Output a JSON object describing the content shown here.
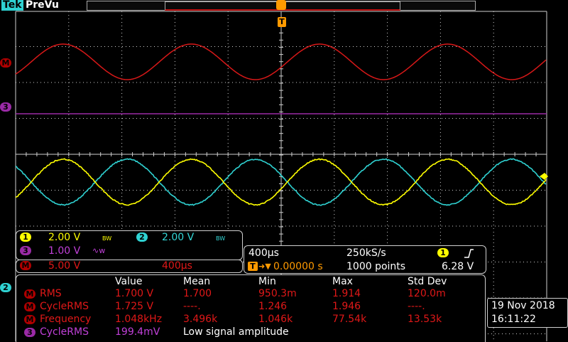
{
  "header": {
    "brand": "Tek",
    "mode": "PreVu"
  },
  "trigger_marker": {
    "label": "T"
  },
  "colors": {
    "ch1": "#ffff00",
    "ch2": "#2fd2d2",
    "ch3": "#9a2aa6",
    "math": "#d81818",
    "graticule": "#cfcfcf"
  },
  "channel_markers": {
    "math": "M",
    "ch3": "3",
    "ch2": "2"
  },
  "channels": {
    "ch1": {
      "badge": "1",
      "scale": "2.00 V",
      "bw": "BW"
    },
    "ch2": {
      "badge": "2",
      "scale": "2.00 V",
      "bw": "BW"
    },
    "ch3": {
      "badge": "3",
      "scale": "1.00 V",
      "filter": "∿w"
    },
    "math": {
      "badge": "M",
      "scale": "5.00 V",
      "time": "400µs"
    }
  },
  "timebase": {
    "horizontal": "400µs",
    "sample_rate": "250kS/s",
    "trigger_source": "1",
    "trigger_slope": "rising",
    "trigger_position": "0.00000 s",
    "record_length": "1000 points",
    "trigger_level": "6.28 V"
  },
  "measurements": {
    "headers": [
      "Value",
      "Mean",
      "Min",
      "Max",
      "Std Dev"
    ],
    "rows": [
      {
        "source": "M",
        "name": "RMS",
        "value": "1.700 V",
        "mean": "1.700",
        "min": "950.3m",
        "max": "1.914",
        "std": "120.0m"
      },
      {
        "source": "M",
        "name": "CycleRMS",
        "value": "1.725 V",
        "mean": "----.",
        "min": "1.246",
        "max": "1.946",
        "std": "----."
      },
      {
        "source": "M",
        "name": "Frequency",
        "value": "1.048kHz",
        "mean": "3.496k",
        "min": "1.046k",
        "max": "77.54k",
        "std": "13.53k"
      },
      {
        "source": "3",
        "name": "CycleRMS",
        "value": "199.4mV",
        "note": "Low signal amplitude"
      }
    ]
  },
  "datetime": {
    "date": "19 Nov 2018",
    "time": "16:11:22"
  }
}
